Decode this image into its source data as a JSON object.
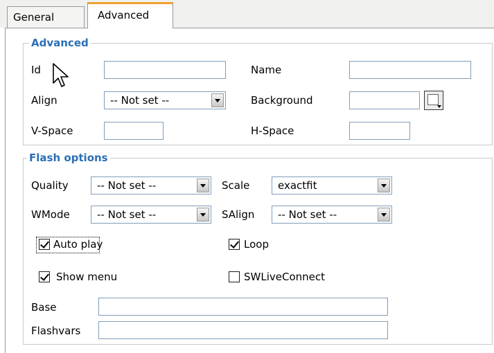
{
  "tabs": {
    "general": "General",
    "advanced": "Advanced",
    "active_accent": "#f0a030"
  },
  "advanced_section": {
    "legend": "Advanced",
    "id_label": "Id",
    "id_value": "",
    "name_label": "Name",
    "name_value": "",
    "align_label": "Align",
    "align_value": "-- Not set --",
    "background_label": "Background",
    "background_value": "",
    "vspace_label": "V-Space",
    "vspace_value": "",
    "hspace_label": "H-Space",
    "hspace_value": ""
  },
  "flash_section": {
    "legend": "Flash options",
    "quality_label": "Quality",
    "quality_value": "-- Not set --",
    "scale_label": "Scale",
    "scale_value": "exactfit",
    "wmode_label": "WMode",
    "wmode_value": "-- Not set --",
    "salign_label": "SAlign",
    "salign_value": "-- Not set --",
    "autoplay_label": "Auto play",
    "autoplay_checked": true,
    "loop_label": "Loop",
    "loop_checked": true,
    "showmenu_label": "Show menu",
    "showmenu_checked": true,
    "swliveconnect_label": "SWLiveConnect",
    "swliveconnect_checked": false,
    "base_label": "Base",
    "base_value": "",
    "flashvars_label": "Flashvars",
    "flashvars_value": ""
  },
  "colors": {
    "legend_color": "#2b6fb6",
    "input_border": "#7f9db9"
  }
}
